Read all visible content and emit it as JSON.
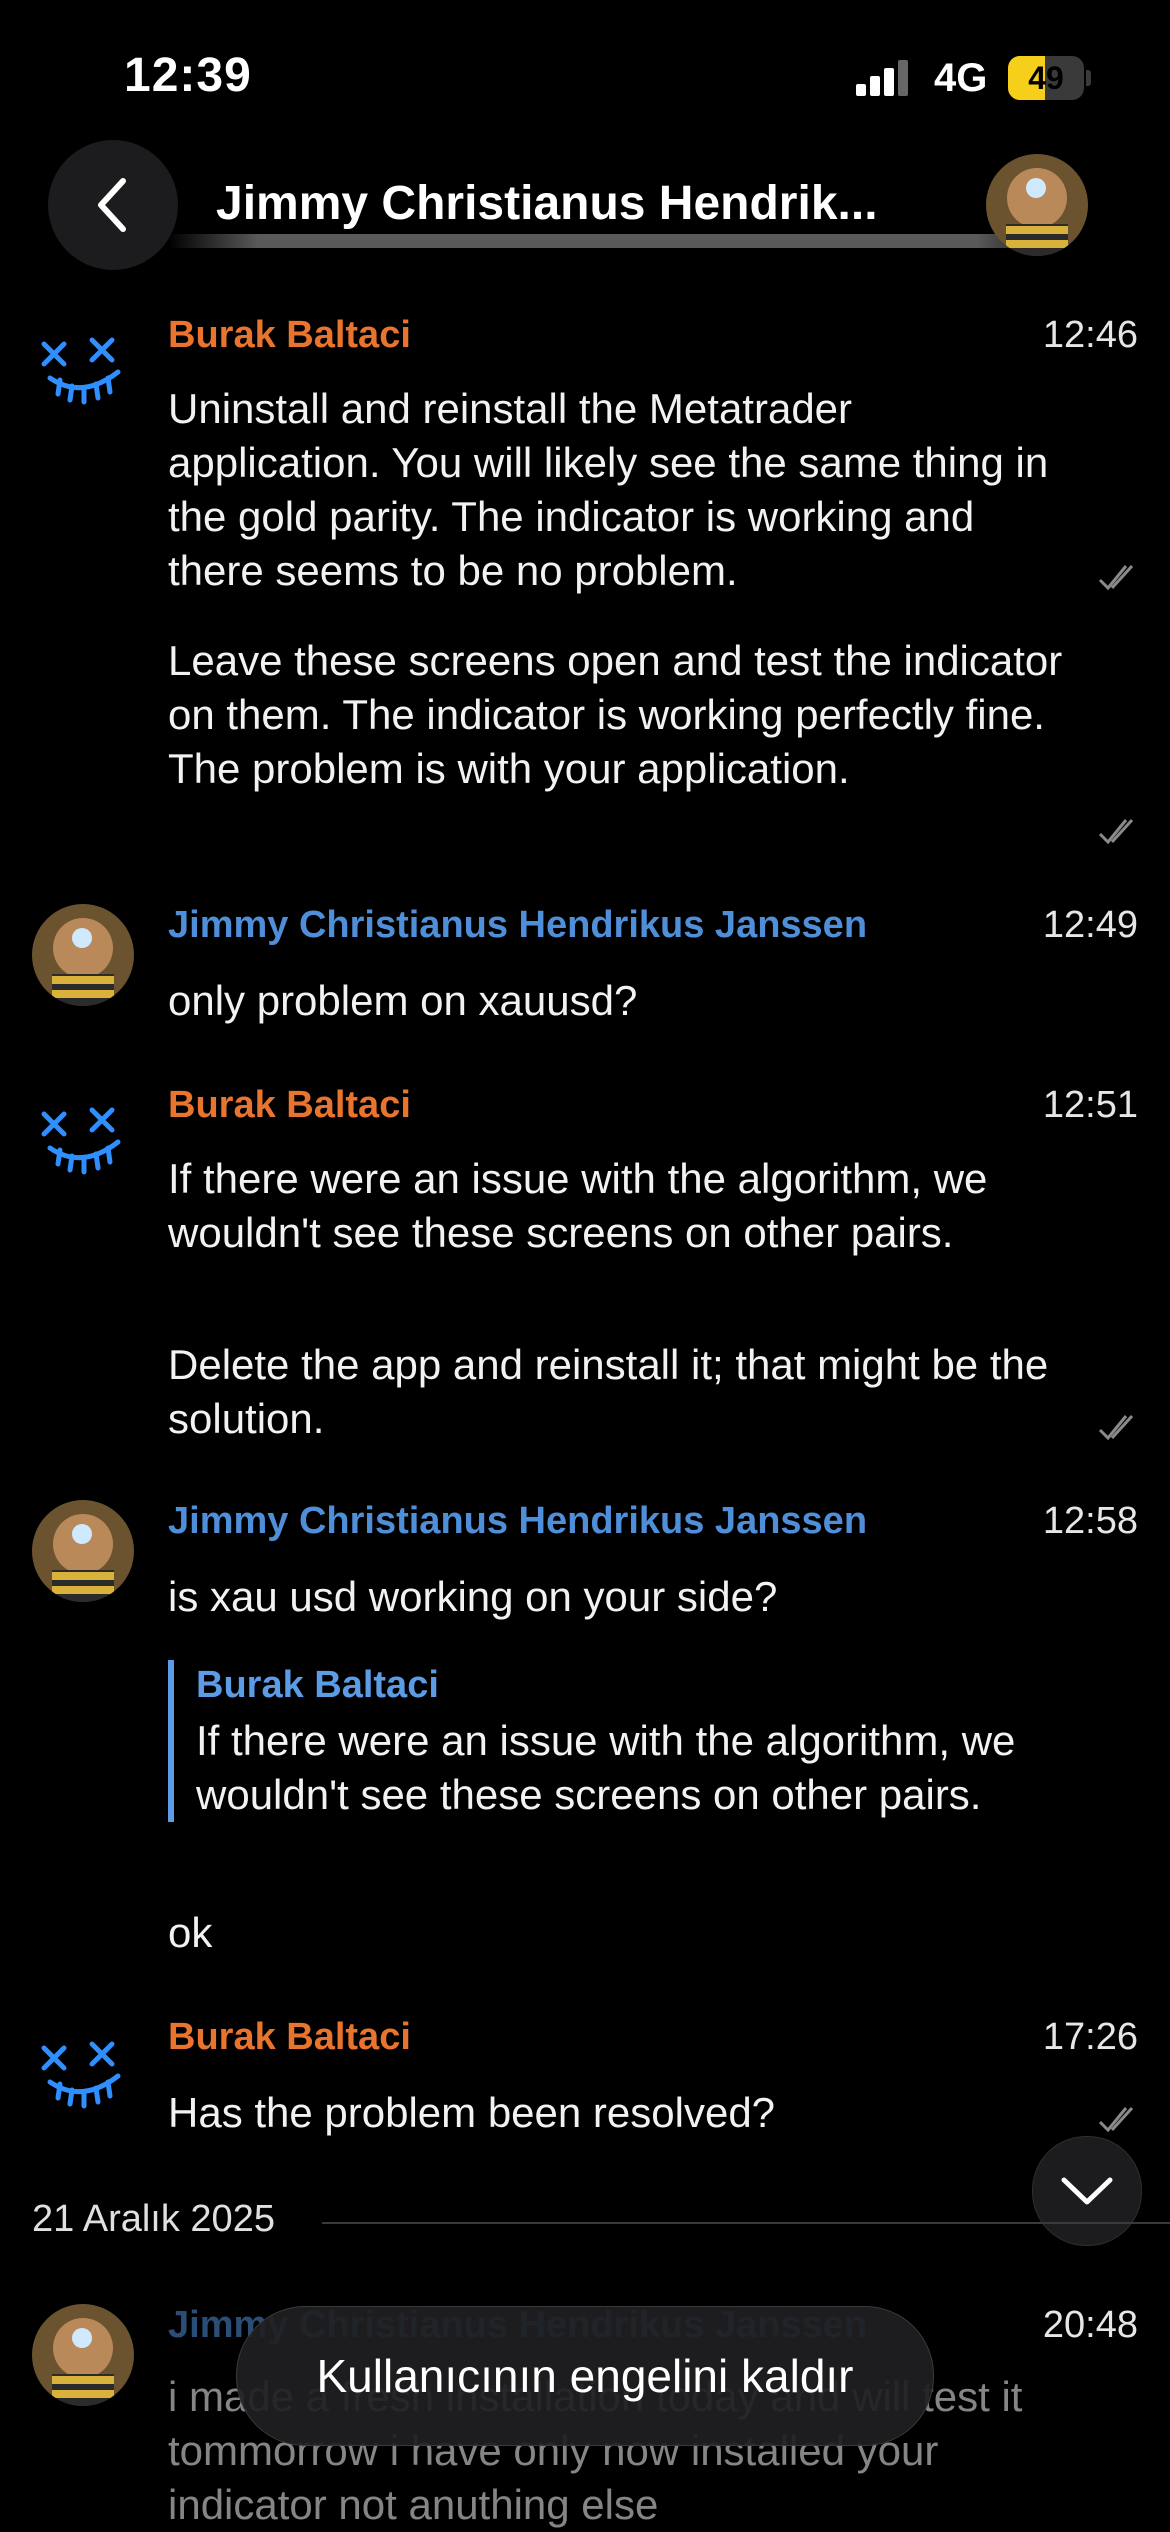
{
  "status_bar": {
    "time": "12:39",
    "network": "4G",
    "battery": "49",
    "signal_bars": 3
  },
  "header": {
    "title": "Jimmy Christianus Hendrik..."
  },
  "messages": [
    {
      "sender": "Burak Baltaci",
      "time": "12:46",
      "paragraphs": [
        "Uninstall and reinstall the Metatrader application. You will likely see the same thing in the gold parity. The indicator is working and there seems to be no problem.",
        "Leave these screens open and test the indicator on them. The indicator is working perfectly fine. The problem is with your application."
      ]
    },
    {
      "sender": "Jimmy Christianus Hendrikus Janssen",
      "time": "12:49",
      "text": "only problem on xauusd?"
    },
    {
      "sender": "Burak Baltaci",
      "time": "12:51",
      "paragraphs": [
        "If there were an issue with the algorithm, we wouldn't see these screens on other pairs.",
        "Delete the app and reinstall it; that might be the solution."
      ]
    },
    {
      "sender": "Jimmy Christianus Hendrikus Janssen",
      "time": "12:58",
      "text": "is xau usd working on your side?",
      "quote": {
        "sender": "Burak Baltaci",
        "text": "If there were an issue with the algorithm, we wouldn't see these screens on other pairs."
      },
      "reply": "ok"
    },
    {
      "sender": "Burak Baltaci",
      "time": "17:26",
      "text": "Has the problem been resolved?"
    },
    {
      "sender": "Jimmy Christianus Hendrikus Janssen",
      "time": "20:48",
      "text": "i made a fresh installation today and will test it tommorrow i have only now installed your indicator not anuthing else"
    }
  ],
  "date_separator": "21 Aralık 2025",
  "unblock_button": "Kullanıcının engelini kaldır",
  "colors": {
    "orange_sender": "#e8742e",
    "blue_sender": "#4f8fd9",
    "quote_bar": "#5c9be5",
    "background": "#000000"
  },
  "icons": [
    "back-chevron-icon",
    "scroll-down-chevron-icon",
    "read-check-icon",
    "neon-mask-avatar",
    "profile-photo-avatar"
  ]
}
